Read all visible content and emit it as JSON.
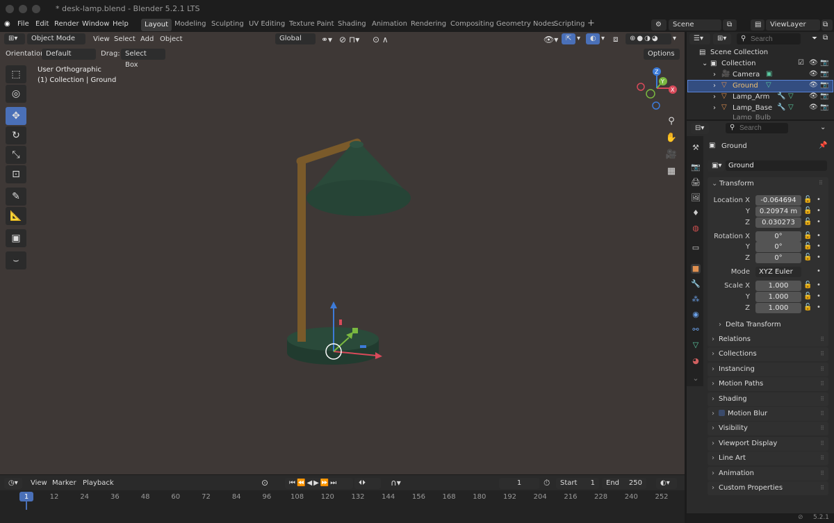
{
  "window": {
    "title": "* desk-lamp.blend - Blender 5.2.1 LTS"
  },
  "menu": {
    "file": "File",
    "edit": "Edit",
    "render": "Render",
    "window": "Window",
    "help": "Help"
  },
  "workspaces": [
    "Layout",
    "Modeling",
    "Sculpting",
    "UV Editing",
    "Texture Paint",
    "Shading",
    "Animation",
    "Rendering",
    "Compositing",
    "Geometry Nodes",
    "Scripting"
  ],
  "scene": {
    "name": "Scene",
    "view_layer": "ViewLayer"
  },
  "header": {
    "mode": "Object Mode",
    "view": "View",
    "select": "Select",
    "add": "Add",
    "object": "Object",
    "transform": "Global",
    "orientation_label": "Orientation:",
    "orientation": "Default",
    "drag_label": "Drag:",
    "drag": "Select Box",
    "options": "Options"
  },
  "viewport": {
    "view_name": "User Orthographic",
    "context": "(1) Collection | Ground",
    "bg_color": "#3e3836"
  },
  "outliner": {
    "search_placeholder": "Search",
    "scene_collection": "Scene Collection",
    "collection": "Collection",
    "items": [
      "Camera",
      "Ground",
      "Lamp_Arm",
      "Lamp_Base",
      "Lamp_Bulb"
    ]
  },
  "properties": {
    "search_placeholder": "Search",
    "object_name": "Ground",
    "data_name": "Ground",
    "transform": "Transform",
    "location_label": "Location X",
    "y": "Y",
    "z": "Z",
    "location": [
      "-0.064694",
      "0.20974 m",
      "0.030273"
    ],
    "rotation_label": "Rotation X",
    "rotation": [
      "0°",
      "0°",
      "0°"
    ],
    "mode_label": "Mode",
    "mode": "XYZ Euler",
    "scale_label": "Scale X",
    "scale": [
      "1.000",
      "1.000",
      "1.000"
    ],
    "delta": "Delta Transform",
    "panels": [
      "Relations",
      "Collections",
      "Instancing",
      "Motion Paths",
      "Shading",
      "Motion Blur",
      "Visibility",
      "Viewport Display",
      "Line Art",
      "Animation",
      "Custom Properties"
    ]
  },
  "timeline": {
    "view": "View",
    "marker": "Marker",
    "playback": "Playback",
    "current_frame": "1",
    "start_label": "Start",
    "start": "1",
    "end_label": "End",
    "end": "250",
    "frames": [
      "1",
      "12",
      "24",
      "36",
      "48",
      "60",
      "72",
      "84",
      "96",
      "108",
      "120",
      "132",
      "144",
      "156",
      "168",
      "180",
      "192",
      "204",
      "216",
      "228",
      "240",
      "252"
    ]
  },
  "status": {
    "version": "5.2.1"
  },
  "colors": {
    "accent": "#4a70b8",
    "lamp_green": "#2a4a3a",
    "arm_brown": "#7a5a2a"
  }
}
